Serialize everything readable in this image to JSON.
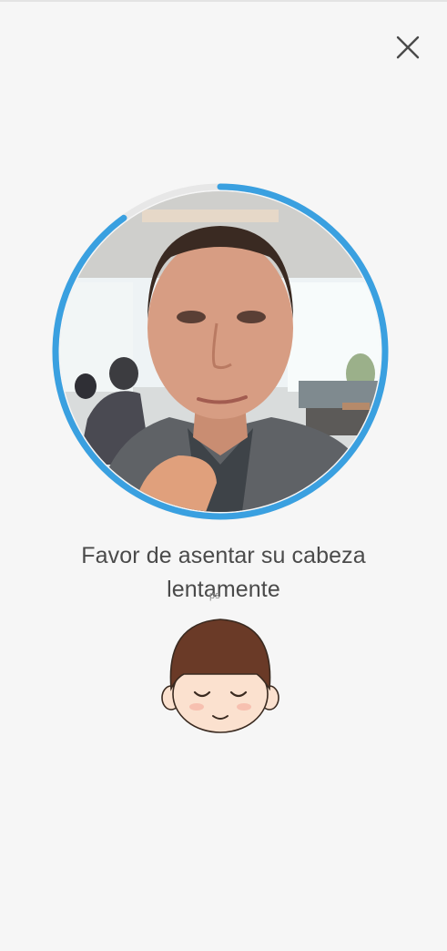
{
  "instruction": {
    "text": "Favor de asentar su cabeza lentamente"
  },
  "overlay_caption": "ps",
  "progress": {
    "fraction": 0.9,
    "track_color": "#e7e7e7",
    "fill_color": "#3aa0e0"
  },
  "icons": {
    "close": "close-icon",
    "guide": "nodding-face-icon"
  },
  "colors": {
    "background": "#f6f6f6",
    "text": "#4a4a4a",
    "accent": "#3aa0e0"
  }
}
